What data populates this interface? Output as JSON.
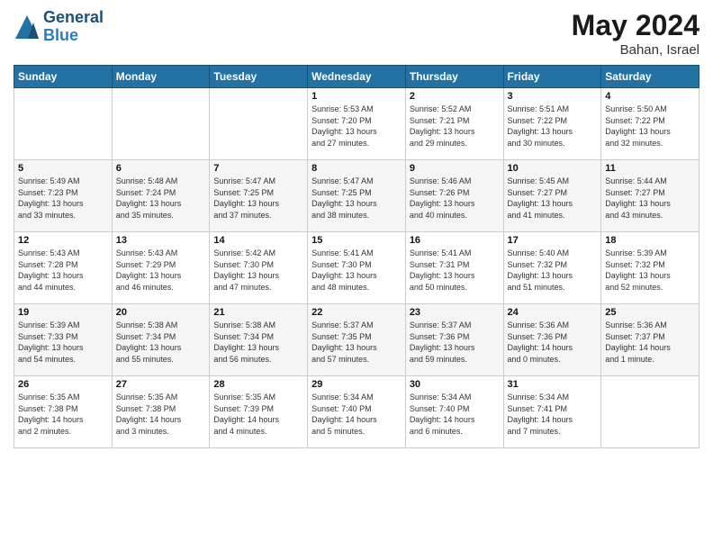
{
  "header": {
    "logo_line1": "General",
    "logo_line2": "Blue",
    "month": "May 2024",
    "location": "Bahan, Israel"
  },
  "weekdays": [
    "Sunday",
    "Monday",
    "Tuesday",
    "Wednesday",
    "Thursday",
    "Friday",
    "Saturday"
  ],
  "weeks": [
    [
      {
        "day": "",
        "info": ""
      },
      {
        "day": "",
        "info": ""
      },
      {
        "day": "",
        "info": ""
      },
      {
        "day": "1",
        "info": "Sunrise: 5:53 AM\nSunset: 7:20 PM\nDaylight: 13 hours\nand 27 minutes."
      },
      {
        "day": "2",
        "info": "Sunrise: 5:52 AM\nSunset: 7:21 PM\nDaylight: 13 hours\nand 29 minutes."
      },
      {
        "day": "3",
        "info": "Sunrise: 5:51 AM\nSunset: 7:22 PM\nDaylight: 13 hours\nand 30 minutes."
      },
      {
        "day": "4",
        "info": "Sunrise: 5:50 AM\nSunset: 7:22 PM\nDaylight: 13 hours\nand 32 minutes."
      }
    ],
    [
      {
        "day": "5",
        "info": "Sunrise: 5:49 AM\nSunset: 7:23 PM\nDaylight: 13 hours\nand 33 minutes."
      },
      {
        "day": "6",
        "info": "Sunrise: 5:48 AM\nSunset: 7:24 PM\nDaylight: 13 hours\nand 35 minutes."
      },
      {
        "day": "7",
        "info": "Sunrise: 5:47 AM\nSunset: 7:25 PM\nDaylight: 13 hours\nand 37 minutes."
      },
      {
        "day": "8",
        "info": "Sunrise: 5:47 AM\nSunset: 7:25 PM\nDaylight: 13 hours\nand 38 minutes."
      },
      {
        "day": "9",
        "info": "Sunrise: 5:46 AM\nSunset: 7:26 PM\nDaylight: 13 hours\nand 40 minutes."
      },
      {
        "day": "10",
        "info": "Sunrise: 5:45 AM\nSunset: 7:27 PM\nDaylight: 13 hours\nand 41 minutes."
      },
      {
        "day": "11",
        "info": "Sunrise: 5:44 AM\nSunset: 7:27 PM\nDaylight: 13 hours\nand 43 minutes."
      }
    ],
    [
      {
        "day": "12",
        "info": "Sunrise: 5:43 AM\nSunset: 7:28 PM\nDaylight: 13 hours\nand 44 minutes."
      },
      {
        "day": "13",
        "info": "Sunrise: 5:43 AM\nSunset: 7:29 PM\nDaylight: 13 hours\nand 46 minutes."
      },
      {
        "day": "14",
        "info": "Sunrise: 5:42 AM\nSunset: 7:30 PM\nDaylight: 13 hours\nand 47 minutes."
      },
      {
        "day": "15",
        "info": "Sunrise: 5:41 AM\nSunset: 7:30 PM\nDaylight: 13 hours\nand 48 minutes."
      },
      {
        "day": "16",
        "info": "Sunrise: 5:41 AM\nSunset: 7:31 PM\nDaylight: 13 hours\nand 50 minutes."
      },
      {
        "day": "17",
        "info": "Sunrise: 5:40 AM\nSunset: 7:32 PM\nDaylight: 13 hours\nand 51 minutes."
      },
      {
        "day": "18",
        "info": "Sunrise: 5:39 AM\nSunset: 7:32 PM\nDaylight: 13 hours\nand 52 minutes."
      }
    ],
    [
      {
        "day": "19",
        "info": "Sunrise: 5:39 AM\nSunset: 7:33 PM\nDaylight: 13 hours\nand 54 minutes."
      },
      {
        "day": "20",
        "info": "Sunrise: 5:38 AM\nSunset: 7:34 PM\nDaylight: 13 hours\nand 55 minutes."
      },
      {
        "day": "21",
        "info": "Sunrise: 5:38 AM\nSunset: 7:34 PM\nDaylight: 13 hours\nand 56 minutes."
      },
      {
        "day": "22",
        "info": "Sunrise: 5:37 AM\nSunset: 7:35 PM\nDaylight: 13 hours\nand 57 minutes."
      },
      {
        "day": "23",
        "info": "Sunrise: 5:37 AM\nSunset: 7:36 PM\nDaylight: 13 hours\nand 59 minutes."
      },
      {
        "day": "24",
        "info": "Sunrise: 5:36 AM\nSunset: 7:36 PM\nDaylight: 14 hours\nand 0 minutes."
      },
      {
        "day": "25",
        "info": "Sunrise: 5:36 AM\nSunset: 7:37 PM\nDaylight: 14 hours\nand 1 minute."
      }
    ],
    [
      {
        "day": "26",
        "info": "Sunrise: 5:35 AM\nSunset: 7:38 PM\nDaylight: 14 hours\nand 2 minutes."
      },
      {
        "day": "27",
        "info": "Sunrise: 5:35 AM\nSunset: 7:38 PM\nDaylight: 14 hours\nand 3 minutes."
      },
      {
        "day": "28",
        "info": "Sunrise: 5:35 AM\nSunset: 7:39 PM\nDaylight: 14 hours\nand 4 minutes."
      },
      {
        "day": "29",
        "info": "Sunrise: 5:34 AM\nSunset: 7:40 PM\nDaylight: 14 hours\nand 5 minutes."
      },
      {
        "day": "30",
        "info": "Sunrise: 5:34 AM\nSunset: 7:40 PM\nDaylight: 14 hours\nand 6 minutes."
      },
      {
        "day": "31",
        "info": "Sunrise: 5:34 AM\nSunset: 7:41 PM\nDaylight: 14 hours\nand 7 minutes."
      },
      {
        "day": "",
        "info": ""
      }
    ]
  ]
}
